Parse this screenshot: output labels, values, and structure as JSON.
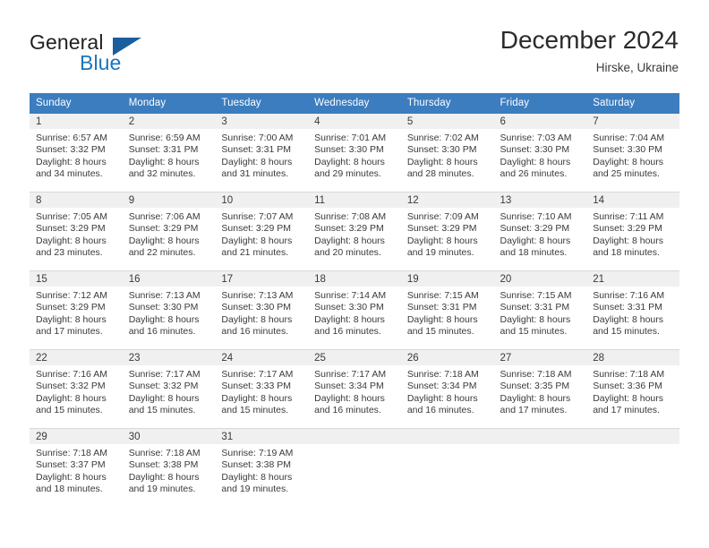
{
  "brand": {
    "name_top": "General",
    "name_bottom": "Blue",
    "triangle_icon": "blue-triangle-icon",
    "colors": {
      "text_dark": "#231f20",
      "blue": "#1b75bb",
      "triangle": "#1b5e9e"
    }
  },
  "header": {
    "title": "December 2024",
    "location": "Hirske, Ukraine"
  },
  "theme": {
    "header_row_bg": "#3b7dbf",
    "daynum_band_bg": "#f0f0f0",
    "cell_bg": "#ffffff",
    "divider": "#d9d9d9",
    "text": "#3a3a3a"
  },
  "weekdays": [
    "Sunday",
    "Monday",
    "Tuesday",
    "Wednesday",
    "Thursday",
    "Friday",
    "Saturday"
  ],
  "weeks": [
    [
      {
        "day": "1",
        "sunrise": "Sunrise: 6:57 AM",
        "sunset": "Sunset: 3:32 PM",
        "daylight_1": "Daylight: 8 hours",
        "daylight_2": "and 34 minutes."
      },
      {
        "day": "2",
        "sunrise": "Sunrise: 6:59 AM",
        "sunset": "Sunset: 3:31 PM",
        "daylight_1": "Daylight: 8 hours",
        "daylight_2": "and 32 minutes."
      },
      {
        "day": "3",
        "sunrise": "Sunrise: 7:00 AM",
        "sunset": "Sunset: 3:31 PM",
        "daylight_1": "Daylight: 8 hours",
        "daylight_2": "and 31 minutes."
      },
      {
        "day": "4",
        "sunrise": "Sunrise: 7:01 AM",
        "sunset": "Sunset: 3:30 PM",
        "daylight_1": "Daylight: 8 hours",
        "daylight_2": "and 29 minutes."
      },
      {
        "day": "5",
        "sunrise": "Sunrise: 7:02 AM",
        "sunset": "Sunset: 3:30 PM",
        "daylight_1": "Daylight: 8 hours",
        "daylight_2": "and 28 minutes."
      },
      {
        "day": "6",
        "sunrise": "Sunrise: 7:03 AM",
        "sunset": "Sunset: 3:30 PM",
        "daylight_1": "Daylight: 8 hours",
        "daylight_2": "and 26 minutes."
      },
      {
        "day": "7",
        "sunrise": "Sunrise: 7:04 AM",
        "sunset": "Sunset: 3:30 PM",
        "daylight_1": "Daylight: 8 hours",
        "daylight_2": "and 25 minutes."
      }
    ],
    [
      {
        "day": "8",
        "sunrise": "Sunrise: 7:05 AM",
        "sunset": "Sunset: 3:29 PM",
        "daylight_1": "Daylight: 8 hours",
        "daylight_2": "and 23 minutes."
      },
      {
        "day": "9",
        "sunrise": "Sunrise: 7:06 AM",
        "sunset": "Sunset: 3:29 PM",
        "daylight_1": "Daylight: 8 hours",
        "daylight_2": "and 22 minutes."
      },
      {
        "day": "10",
        "sunrise": "Sunrise: 7:07 AM",
        "sunset": "Sunset: 3:29 PM",
        "daylight_1": "Daylight: 8 hours",
        "daylight_2": "and 21 minutes."
      },
      {
        "day": "11",
        "sunrise": "Sunrise: 7:08 AM",
        "sunset": "Sunset: 3:29 PM",
        "daylight_1": "Daylight: 8 hours",
        "daylight_2": "and 20 minutes."
      },
      {
        "day": "12",
        "sunrise": "Sunrise: 7:09 AM",
        "sunset": "Sunset: 3:29 PM",
        "daylight_1": "Daylight: 8 hours",
        "daylight_2": "and 19 minutes."
      },
      {
        "day": "13",
        "sunrise": "Sunrise: 7:10 AM",
        "sunset": "Sunset: 3:29 PM",
        "daylight_1": "Daylight: 8 hours",
        "daylight_2": "and 18 minutes."
      },
      {
        "day": "14",
        "sunrise": "Sunrise: 7:11 AM",
        "sunset": "Sunset: 3:29 PM",
        "daylight_1": "Daylight: 8 hours",
        "daylight_2": "and 18 minutes."
      }
    ],
    [
      {
        "day": "15",
        "sunrise": "Sunrise: 7:12 AM",
        "sunset": "Sunset: 3:29 PM",
        "daylight_1": "Daylight: 8 hours",
        "daylight_2": "and 17 minutes."
      },
      {
        "day": "16",
        "sunrise": "Sunrise: 7:13 AM",
        "sunset": "Sunset: 3:30 PM",
        "daylight_1": "Daylight: 8 hours",
        "daylight_2": "and 16 minutes."
      },
      {
        "day": "17",
        "sunrise": "Sunrise: 7:13 AM",
        "sunset": "Sunset: 3:30 PM",
        "daylight_1": "Daylight: 8 hours",
        "daylight_2": "and 16 minutes."
      },
      {
        "day": "18",
        "sunrise": "Sunrise: 7:14 AM",
        "sunset": "Sunset: 3:30 PM",
        "daylight_1": "Daylight: 8 hours",
        "daylight_2": "and 16 minutes."
      },
      {
        "day": "19",
        "sunrise": "Sunrise: 7:15 AM",
        "sunset": "Sunset: 3:31 PM",
        "daylight_1": "Daylight: 8 hours",
        "daylight_2": "and 15 minutes."
      },
      {
        "day": "20",
        "sunrise": "Sunrise: 7:15 AM",
        "sunset": "Sunset: 3:31 PM",
        "daylight_1": "Daylight: 8 hours",
        "daylight_2": "and 15 minutes."
      },
      {
        "day": "21",
        "sunrise": "Sunrise: 7:16 AM",
        "sunset": "Sunset: 3:31 PM",
        "daylight_1": "Daylight: 8 hours",
        "daylight_2": "and 15 minutes."
      }
    ],
    [
      {
        "day": "22",
        "sunrise": "Sunrise: 7:16 AM",
        "sunset": "Sunset: 3:32 PM",
        "daylight_1": "Daylight: 8 hours",
        "daylight_2": "and 15 minutes."
      },
      {
        "day": "23",
        "sunrise": "Sunrise: 7:17 AM",
        "sunset": "Sunset: 3:32 PM",
        "daylight_1": "Daylight: 8 hours",
        "daylight_2": "and 15 minutes."
      },
      {
        "day": "24",
        "sunrise": "Sunrise: 7:17 AM",
        "sunset": "Sunset: 3:33 PM",
        "daylight_1": "Daylight: 8 hours",
        "daylight_2": "and 15 minutes."
      },
      {
        "day": "25",
        "sunrise": "Sunrise: 7:17 AM",
        "sunset": "Sunset: 3:34 PM",
        "daylight_1": "Daylight: 8 hours",
        "daylight_2": "and 16 minutes."
      },
      {
        "day": "26",
        "sunrise": "Sunrise: 7:18 AM",
        "sunset": "Sunset: 3:34 PM",
        "daylight_1": "Daylight: 8 hours",
        "daylight_2": "and 16 minutes."
      },
      {
        "day": "27",
        "sunrise": "Sunrise: 7:18 AM",
        "sunset": "Sunset: 3:35 PM",
        "daylight_1": "Daylight: 8 hours",
        "daylight_2": "and 17 minutes."
      },
      {
        "day": "28",
        "sunrise": "Sunrise: 7:18 AM",
        "sunset": "Sunset: 3:36 PM",
        "daylight_1": "Daylight: 8 hours",
        "daylight_2": "and 17 minutes."
      }
    ],
    [
      {
        "day": "29",
        "sunrise": "Sunrise: 7:18 AM",
        "sunset": "Sunset: 3:37 PM",
        "daylight_1": "Daylight: 8 hours",
        "daylight_2": "and 18 minutes."
      },
      {
        "day": "30",
        "sunrise": "Sunrise: 7:18 AM",
        "sunset": "Sunset: 3:38 PM",
        "daylight_1": "Daylight: 8 hours",
        "daylight_2": "and 19 minutes."
      },
      {
        "day": "31",
        "sunrise": "Sunrise: 7:19 AM",
        "sunset": "Sunset: 3:38 PM",
        "daylight_1": "Daylight: 8 hours",
        "daylight_2": "and 19 minutes."
      },
      {
        "day": "",
        "sunrise": "",
        "sunset": "",
        "daylight_1": "",
        "daylight_2": ""
      },
      {
        "day": "",
        "sunrise": "",
        "sunset": "",
        "daylight_1": "",
        "daylight_2": ""
      },
      {
        "day": "",
        "sunrise": "",
        "sunset": "",
        "daylight_1": "",
        "daylight_2": ""
      },
      {
        "day": "",
        "sunrise": "",
        "sunset": "",
        "daylight_1": "",
        "daylight_2": ""
      }
    ]
  ]
}
